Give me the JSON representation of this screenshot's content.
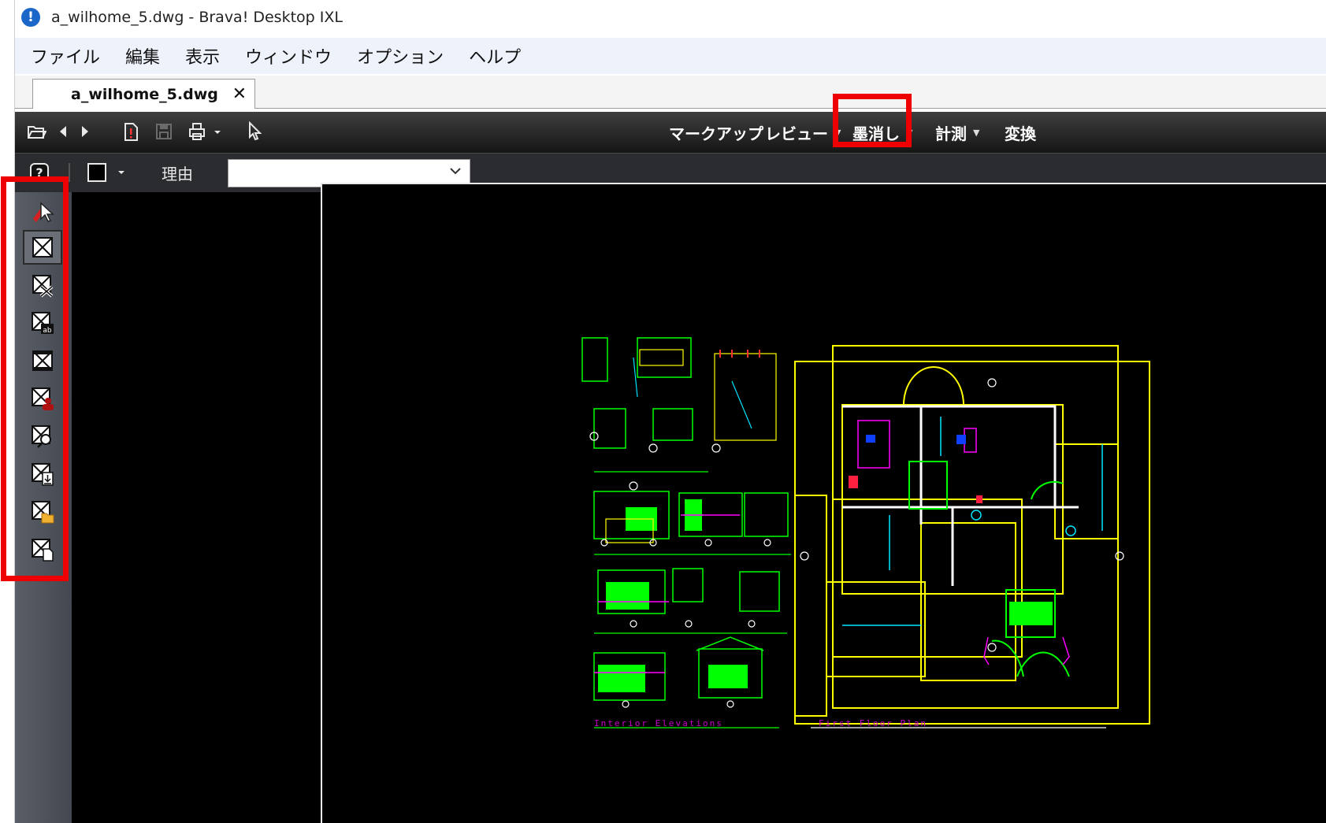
{
  "window": {
    "title": "a_wilhome_5.dwg - Brava! Desktop IXL",
    "app_icon_glyph": "!"
  },
  "menu": {
    "items": [
      "ファイル",
      "編集",
      "表示",
      "ウィンドウ",
      "オプション",
      "ヘルプ"
    ]
  },
  "tab": {
    "label": "a_wilhome_5.dwg",
    "close_glyph": "✕"
  },
  "toolbar": {
    "icons": [
      "open-folder-icon",
      "back-arrow-icon",
      "forward-arrow-icon",
      "document-alert-icon",
      "save-icon",
      "print-icon",
      "cursor-select-icon"
    ],
    "menus": [
      {
        "label": "マークアップ",
        "has_dropdown": false
      },
      {
        "label": "レビュー",
        "has_dropdown": true
      },
      {
        "label": "墨消し",
        "has_dropdown": true,
        "highlighted": true
      },
      {
        "label": "計測",
        "has_dropdown": true
      },
      {
        "label": "変換",
        "has_dropdown": false
      }
    ]
  },
  "secondary_toolbar": {
    "help_icon": "help-icon",
    "color_swatch": "#000000",
    "reason_label": "理由",
    "reason_value": ""
  },
  "redaction_tools": [
    {
      "name": "redaction-select-icon",
      "active": false
    },
    {
      "name": "redact-area-icon",
      "active": true
    },
    {
      "name": "redact-area-x-icon",
      "active": false
    },
    {
      "name": "redact-text-icon",
      "active": false
    },
    {
      "name": "redact-full-page-icon",
      "active": false
    },
    {
      "name": "redact-personal-icon",
      "active": false
    },
    {
      "name": "redact-search-icon",
      "active": false
    },
    {
      "name": "redact-import-icon",
      "active": false
    },
    {
      "name": "redact-folder-icon",
      "active": false
    },
    {
      "name": "redact-document-icon",
      "active": false
    }
  ],
  "drawing": {
    "labels": [
      "Interior Elevations",
      "First Floor Plan"
    ]
  },
  "colors": {
    "highlight": "#ee0000",
    "cad_yellow": "#ffff00",
    "cad_green": "#00ff00",
    "cad_cyan": "#00e5ff",
    "cad_magenta": "#ff00ff"
  }
}
